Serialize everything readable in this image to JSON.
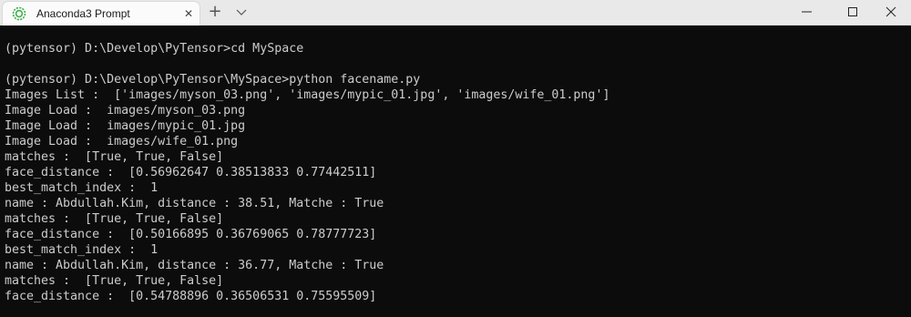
{
  "window": {
    "tab_title": "Anaconda3 Prompt",
    "new_tab_symbol": "+",
    "close_symbol": "✕",
    "icon": "anaconda-icon",
    "accent_color": "#3fb24f"
  },
  "terminal": {
    "background": "#0c0c0c",
    "foreground": "#cccccc",
    "lines": [
      "(pytensor) D:\\Develop\\PyTensor>cd MySpace",
      "",
      "(pytensor) D:\\Develop\\PyTensor\\MySpace>python facename.py",
      "Images List :  ['images/myson_03.png', 'images/mypic_01.jpg', 'images/wife_01.png']",
      "Image Load :  images/myson_03.png",
      "Image Load :  images/mypic_01.jpg",
      "Image Load :  images/wife_01.png",
      "matches :  [True, True, False]",
      "face_distance :  [0.56962647 0.38513833 0.77442511]",
      "best_match_index :  1",
      "name : Abdullah.Kim, distance : 38.51, Matche : True",
      "matches :  [True, True, False]",
      "face_distance :  [0.50166895 0.36769065 0.78777723]",
      "best_match_index :  1",
      "name : Abdullah.Kim, distance : 36.77, Matche : True",
      "matches :  [True, True, False]",
      "face_distance :  [0.54788896 0.36506531 0.75595509]"
    ]
  }
}
